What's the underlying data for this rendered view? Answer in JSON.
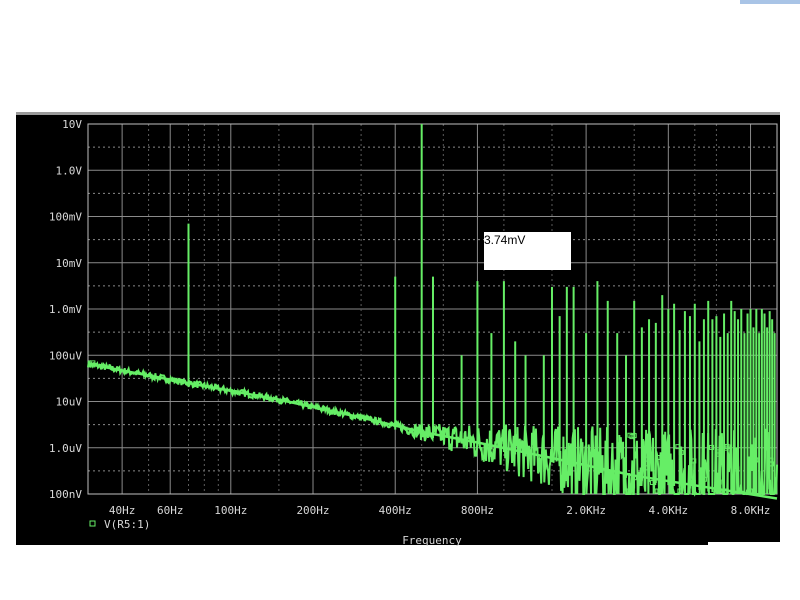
{
  "chart_data": {
    "type": "line",
    "xscale": "log",
    "yscale": "log",
    "xlim": [
      30,
      10000
    ],
    "ylim": [
      1e-07,
      10
    ],
    "xlabel": "Frequency",
    "x_ticks": [
      {
        "value": 40,
        "label": "40Hz"
      },
      {
        "value": 60,
        "label": "60Hz"
      },
      {
        "value": 100,
        "label": "100Hz"
      },
      {
        "value": 200,
        "label": "200Hz"
      },
      {
        "value": 400,
        "label": "400Hz"
      },
      {
        "value": 800,
        "label": "800Hz"
      },
      {
        "value": 2000,
        "label": "2.0KHz"
      },
      {
        "value": 4000,
        "label": "4.0KHz"
      },
      {
        "value": 8000,
        "label": "8.0KHz"
      }
    ],
    "y_ticks": [
      {
        "value": 10,
        "label": "10V"
      },
      {
        "value": 1,
        "label": "1.0V"
      },
      {
        "value": 0.1,
        "label": "100mV"
      },
      {
        "value": 0.01,
        "label": "10mV"
      },
      {
        "value": 0.001,
        "label": "1.0mV"
      },
      {
        "value": 0.0001,
        "label": "100uV"
      },
      {
        "value": 1e-05,
        "label": "10uV"
      },
      {
        "value": 1e-06,
        "label": "1.0uV"
      },
      {
        "value": 1e-07,
        "label": "100nV"
      }
    ],
    "grid": true,
    "legend": {
      "position": "bottom-left",
      "entries": [
        "V(R5:1)"
      ]
    },
    "series": [
      {
        "name": "V(R5:1)",
        "color": "#66ee66",
        "baseline": [
          [
            30,
            6.5e-05
          ],
          [
            70,
            2.5e-05
          ],
          [
            150,
            1.1e-05
          ],
          [
            300,
            4.5e-06
          ],
          [
            500,
            2.2e-06
          ],
          [
            800,
            1.3e-06
          ],
          [
            1500,
            6e-07
          ],
          [
            3000,
            2.5e-07
          ],
          [
            10000,
            8e-08
          ]
        ],
        "peaks": [
          [
            70,
            0.07
          ],
          [
            400,
            0.005
          ],
          [
            500,
            10
          ],
          [
            550,
            0.005
          ],
          [
            700,
            0.0001
          ],
          [
            800,
            0.004
          ],
          [
            900,
            0.0003
          ],
          [
            1000,
            0.004
          ],
          [
            1100,
            0.0002
          ],
          [
            1200,
            0.0001
          ],
          [
            1400,
            0.0001
          ],
          [
            1500,
            0.003
          ],
          [
            1600,
            0.0007
          ],
          [
            1700,
            0.003
          ],
          [
            1800,
            0.003
          ],
          [
            2000,
            0.0003
          ],
          [
            2200,
            0.004
          ],
          [
            2400,
            0.0015
          ],
          [
            2600,
            0.0003
          ],
          [
            2800,
            0.0001
          ],
          [
            3000,
            0.0015
          ],
          [
            3200,
            0.0004
          ],
          [
            3400,
            0.0006
          ],
          [
            3600,
            0.0005
          ],
          [
            3800,
            0.002
          ],
          [
            4000,
            0.001
          ],
          [
            4200,
            0.0013
          ],
          [
            4400,
            0.00035
          ],
          [
            4600,
            0.0009
          ],
          [
            4800,
            0.0007
          ],
          [
            5000,
            0.0013
          ],
          [
            5200,
            0.0002
          ],
          [
            5400,
            0.0006
          ],
          [
            5600,
            0.0015
          ],
          [
            5800,
            0.0006
          ],
          [
            6000,
            0.0007
          ],
          [
            6200,
            0.00025
          ],
          [
            6400,
            0.0008
          ],
          [
            6600,
            0.0003
          ],
          [
            6800,
            0.0015
          ],
          [
            7000,
            0.0009
          ],
          [
            7200,
            0.0006
          ],
          [
            7400,
            0.001
          ],
          [
            7600,
            0.0003
          ],
          [
            7800,
            0.0008
          ],
          [
            8000,
            0.001
          ],
          [
            8200,
            0.0004
          ],
          [
            8400,
            0.001
          ],
          [
            8600,
            0.0003
          ],
          [
            8800,
            0.001
          ],
          [
            9000,
            0.0008
          ],
          [
            9200,
            0.0004
          ],
          [
            9400,
            0.0009
          ],
          [
            9600,
            0.0006
          ],
          [
            9800,
            0.0003
          ]
        ]
      }
    ],
    "annotation": {
      "text": "3.74mV",
      "x": 1050,
      "y": 0.00374
    }
  }
}
